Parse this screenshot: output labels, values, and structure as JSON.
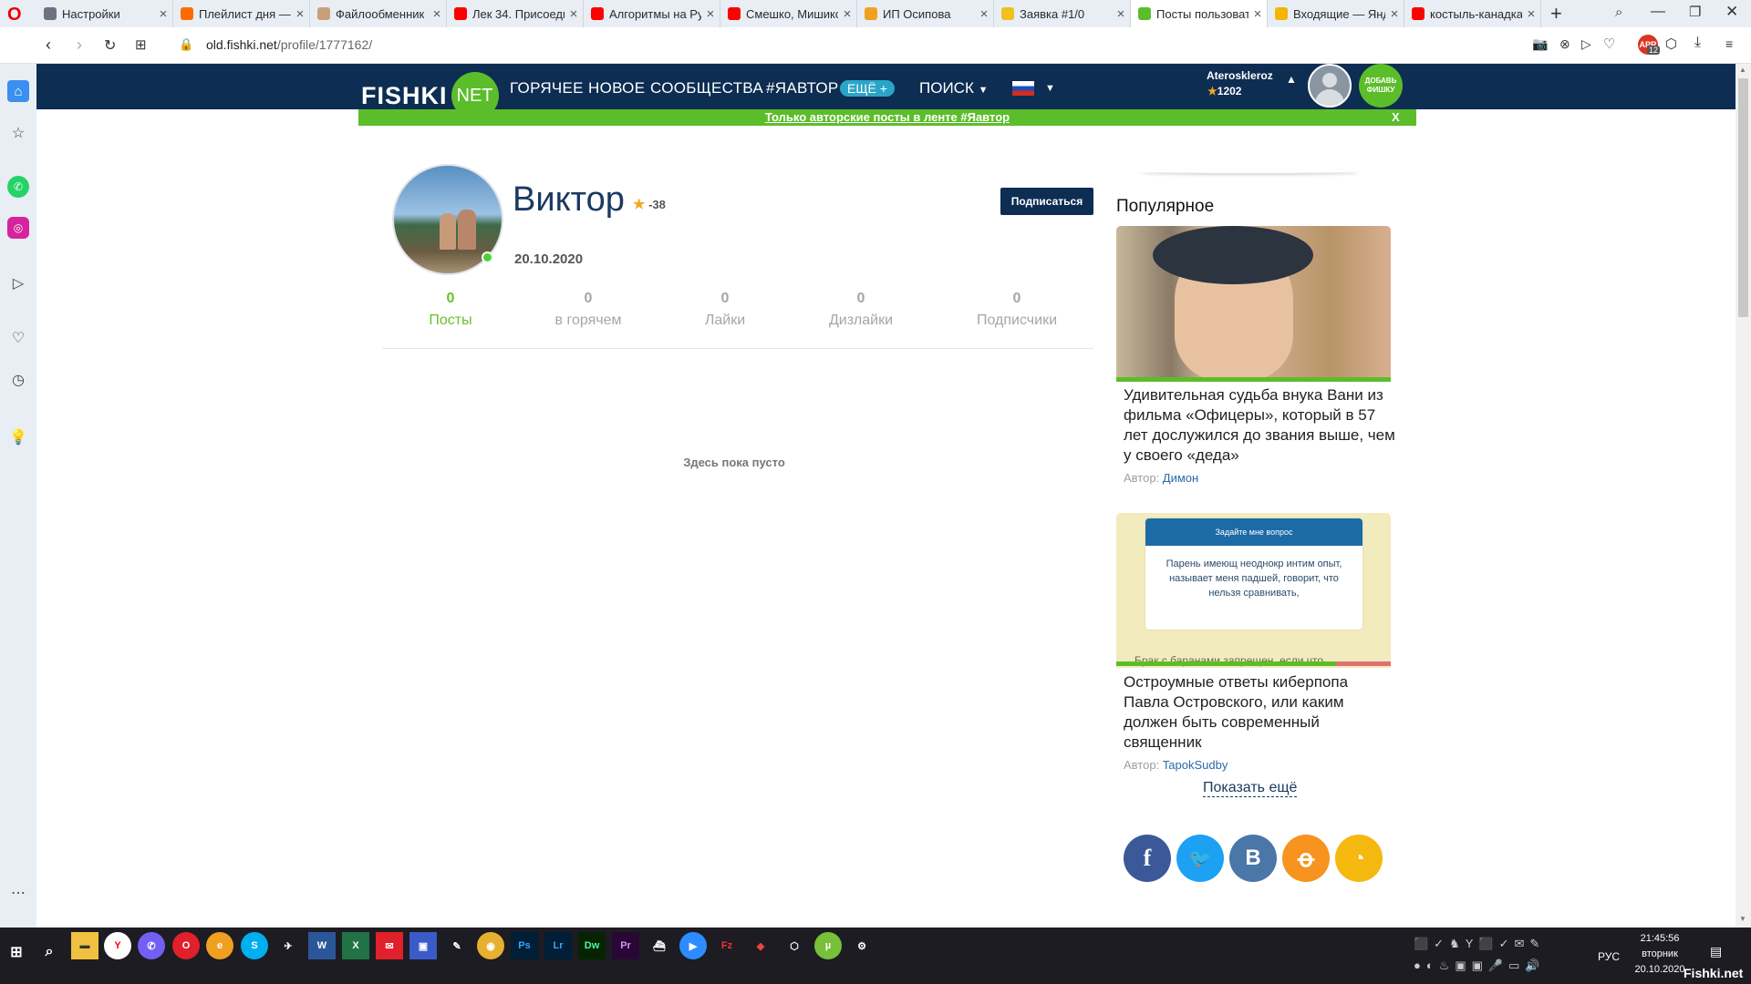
{
  "browser": {
    "tabs": [
      {
        "label": "Настройки",
        "icon": "gear-icon",
        "color": "#6b7280"
      },
      {
        "label": "Плейлист дня —",
        "icon": "music-icon",
        "color": "#ff6a00"
      },
      {
        "label": "Файлообменник",
        "icon": "file-icon",
        "color": "#c8a07a"
      },
      {
        "label": "Лек 34. Присоеди",
        "icon": "youtube-icon",
        "color": "#ff0000"
      },
      {
        "label": "Алгоритмы на Ру",
        "icon": "youtube-icon",
        "color": "#ff0000"
      },
      {
        "label": "Смешко, Мишико",
        "icon": "youtube-icon",
        "color": "#ff0000"
      },
      {
        "label": "ИП Осипова",
        "icon": "sun-icon",
        "color": "#f0a020"
      },
      {
        "label": "Заявка #1/0",
        "icon": "star-icon",
        "color": "#f0c020"
      },
      {
        "label": "Посты пользоват",
        "icon": "fishki-icon",
        "color": "#5cbd2a"
      },
      {
        "label": "Входящие — Янд",
        "icon": "mail-icon",
        "color": "#f4b400"
      },
      {
        "label": "костыль-канадка",
        "icon": "yandex-icon",
        "color": "#ff0000"
      }
    ],
    "new_tab": "+",
    "url_host": "old.fishki.net",
    "url_path": "/profile/1777162/",
    "apr_badge": "12"
  },
  "site": {
    "logo_text": "FISHKI",
    "logo_net": "NET",
    "nav": [
      "ГОРЯЧЕЕ",
      "НОВОЕ",
      "СООБЩЕСТВА",
      "#ЯАВТОР"
    ],
    "more": "ЕЩЁ +",
    "search": "ПОИСК",
    "user_name": "Ateroskleroz",
    "user_rating": "1202",
    "add_btn": "ДОБАВЬ ФИШКУ",
    "promo": "Только авторские посты в ленте #Яавтор",
    "promo_close": "X"
  },
  "profile": {
    "name": "Виктор",
    "rating": "-38",
    "date": "20.10.2020",
    "subscribe": "Подписаться",
    "stats": [
      {
        "value": "0",
        "label": "Посты",
        "active": true
      },
      {
        "value": "0",
        "label": "в горячем"
      },
      {
        "value": "0",
        "label": "Лайки"
      },
      {
        "value": "0",
        "label": "Дизлайки"
      },
      {
        "value": "0",
        "label": "Подписчики"
      }
    ],
    "empty": "Здесь пока пусто"
  },
  "popular": {
    "title": "Популярное",
    "cards": [
      {
        "title": "Удивительная судьба внука Вани из фильма «Офицеры», который в 57 лет дослужился до звания выше, чем у своего «деда»",
        "author_label": "Автор:",
        "author": "Димон"
      },
      {
        "title": "Остроумные ответы киберпопа Павла Островского, или каким должен быть современный священник",
        "author_label": "Автор:",
        "author": "TapokSudby",
        "img_header": "Задайте мне вопрос",
        "img_text": "Парень имеющ неоднокр интим опыт, называет меня падшей, говорит, что нельзя сравнивать,",
        "img_bottom": "Брак с баранами запрещен, если что."
      }
    ],
    "more": "Показать ещё"
  },
  "social": [
    {
      "glyph": "f",
      "color": "#3b5998",
      "icon": "facebook-icon"
    },
    {
      "glyph": "🐦",
      "color": "#1da1f2",
      "icon": "twitter-icon"
    },
    {
      "glyph": "В",
      "color": "#4a76a8",
      "icon": "vk-icon"
    },
    {
      "glyph": "ok",
      "color": "#f7931e",
      "icon": "odnoklassniki-icon"
    },
    {
      "glyph": "rss",
      "color": "#f5b80f",
      "icon": "rss-icon"
    }
  ],
  "taskbar": {
    "lang": "РУС",
    "time": "21:45:56",
    "day": "вторник",
    "date": "20.10.2020",
    "watermark": "Fishki.net"
  }
}
